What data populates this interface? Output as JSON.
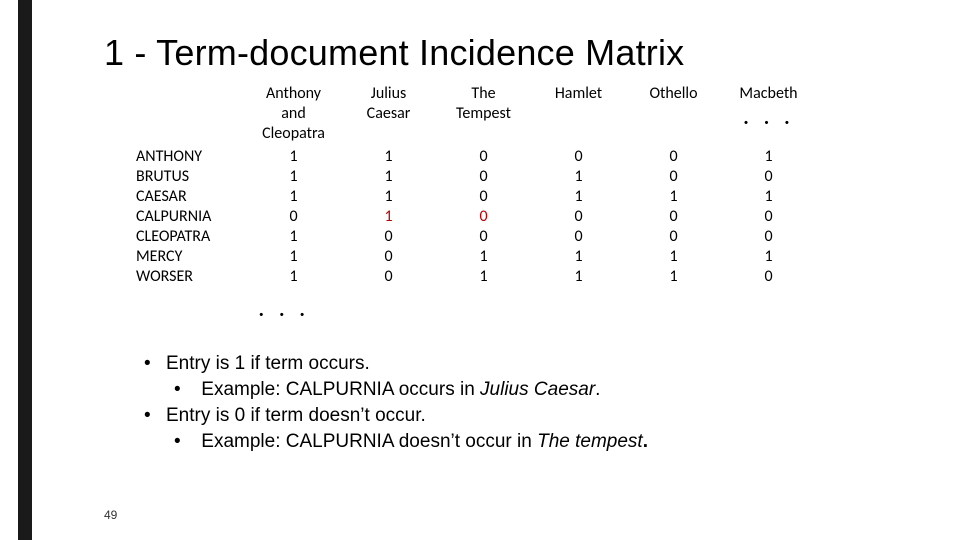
{
  "title": "1 - Term-document Incidence Matrix",
  "docs": [
    "Anthony and Cleopatra",
    "Julius Caesar",
    "The Tempest",
    "Hamlet",
    "Othello",
    "Macbeth"
  ],
  "doc_lines": [
    [
      "Anthony",
      "and",
      "Cleopatra"
    ],
    [
      "Julius",
      "Caesar"
    ],
    [
      "The",
      "Tempest"
    ],
    [
      "Hamlet"
    ],
    [
      "Othello"
    ],
    [
      "Macbeth"
    ]
  ],
  "doc_ellipsis": ". . .",
  "terms": [
    "ANTHONY",
    "BRUTUS",
    "CAESAR",
    "CALPURNIA",
    "CLEOPATRA",
    "MERCY",
    "WORSER"
  ],
  "matrix": [
    [
      1,
      1,
      0,
      0,
      0,
      1
    ],
    [
      1,
      1,
      0,
      1,
      0,
      0
    ],
    [
      1,
      1,
      0,
      1,
      1,
      1
    ],
    [
      0,
      1,
      0,
      0,
      0,
      0
    ],
    [
      1,
      0,
      0,
      0,
      0,
      0
    ],
    [
      1,
      0,
      1,
      1,
      1,
      1
    ],
    [
      1,
      0,
      1,
      1,
      1,
      0
    ]
  ],
  "red_cells": [
    [
      3,
      1
    ],
    [
      3,
      2
    ]
  ],
  "row_ellipsis": ". . .",
  "bullets": {
    "b1": "Entry is 1 if term occurs.",
    "b1a_pre": "Example: CALPURNIA occurs in ",
    "b1a_em": "Julius Caesar",
    "b1a_post": ".",
    "b2": "Entry is 0 if term doesn’t occur.",
    "b2a_pre": "Example: CALPURNIA doesn’t occur in ",
    "b2a_em": "The tempest",
    "b2a_post": "."
  },
  "page": "49",
  "chart_data": {
    "type": "table",
    "title": "Term-document Incidence Matrix",
    "columns": [
      "Anthony and Cleopatra",
      "Julius Caesar",
      "The Tempest",
      "Hamlet",
      "Othello",
      "Macbeth"
    ],
    "rows": [
      "ANTHONY",
      "BRUTUS",
      "CAESAR",
      "CALPURNIA",
      "CLEOPATRA",
      "MERCY",
      "WORSER"
    ],
    "values": [
      [
        1,
        1,
        0,
        0,
        0,
        1
      ],
      [
        1,
        1,
        0,
        1,
        0,
        0
      ],
      [
        1,
        1,
        0,
        1,
        1,
        1
      ],
      [
        0,
        1,
        0,
        0,
        0,
        0
      ],
      [
        1,
        0,
        0,
        0,
        0,
        0
      ],
      [
        1,
        0,
        1,
        1,
        1,
        1
      ],
      [
        1,
        0,
        1,
        1,
        1,
        0
      ]
    ]
  }
}
